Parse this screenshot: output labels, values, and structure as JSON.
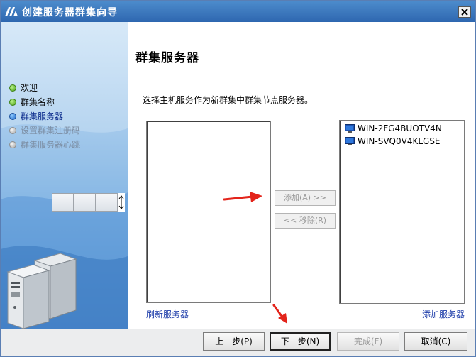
{
  "window": {
    "title": "创建服务器群集向导"
  },
  "sidebar": {
    "steps": [
      {
        "label": "欢迎",
        "state": "done"
      },
      {
        "label": "群集名称",
        "state": "done"
      },
      {
        "label": "群集服务器",
        "state": "current"
      },
      {
        "label": "设置群集注册码",
        "state": "pending"
      },
      {
        "label": "群集服务器心跳",
        "state": "pending"
      }
    ]
  },
  "main": {
    "heading": "群集服务器",
    "instruction": "选择主机服务作为新群集中群集节点服务器。",
    "available_servers": [],
    "selected_servers": [
      {
        "name": "WIN-2FG4BUOTV4N",
        "icon": "computer-icon"
      },
      {
        "name": "WIN-SVQ0V4KLGSE",
        "icon": "computer-icon"
      }
    ],
    "add_button": "添加(A) >>",
    "remove_button": "<< 移除(R)",
    "refresh_link": "刷新服务器",
    "add_server_link": "添加服务器"
  },
  "footer": {
    "prev": "上一步(P)",
    "next": "下一步(N)",
    "finish": "完成(F)",
    "cancel": "取消(C)"
  },
  "colors": {
    "titlebar": "#2e67b0",
    "link": "#1a3aa8",
    "annotation_arrow": "#e3241b"
  }
}
